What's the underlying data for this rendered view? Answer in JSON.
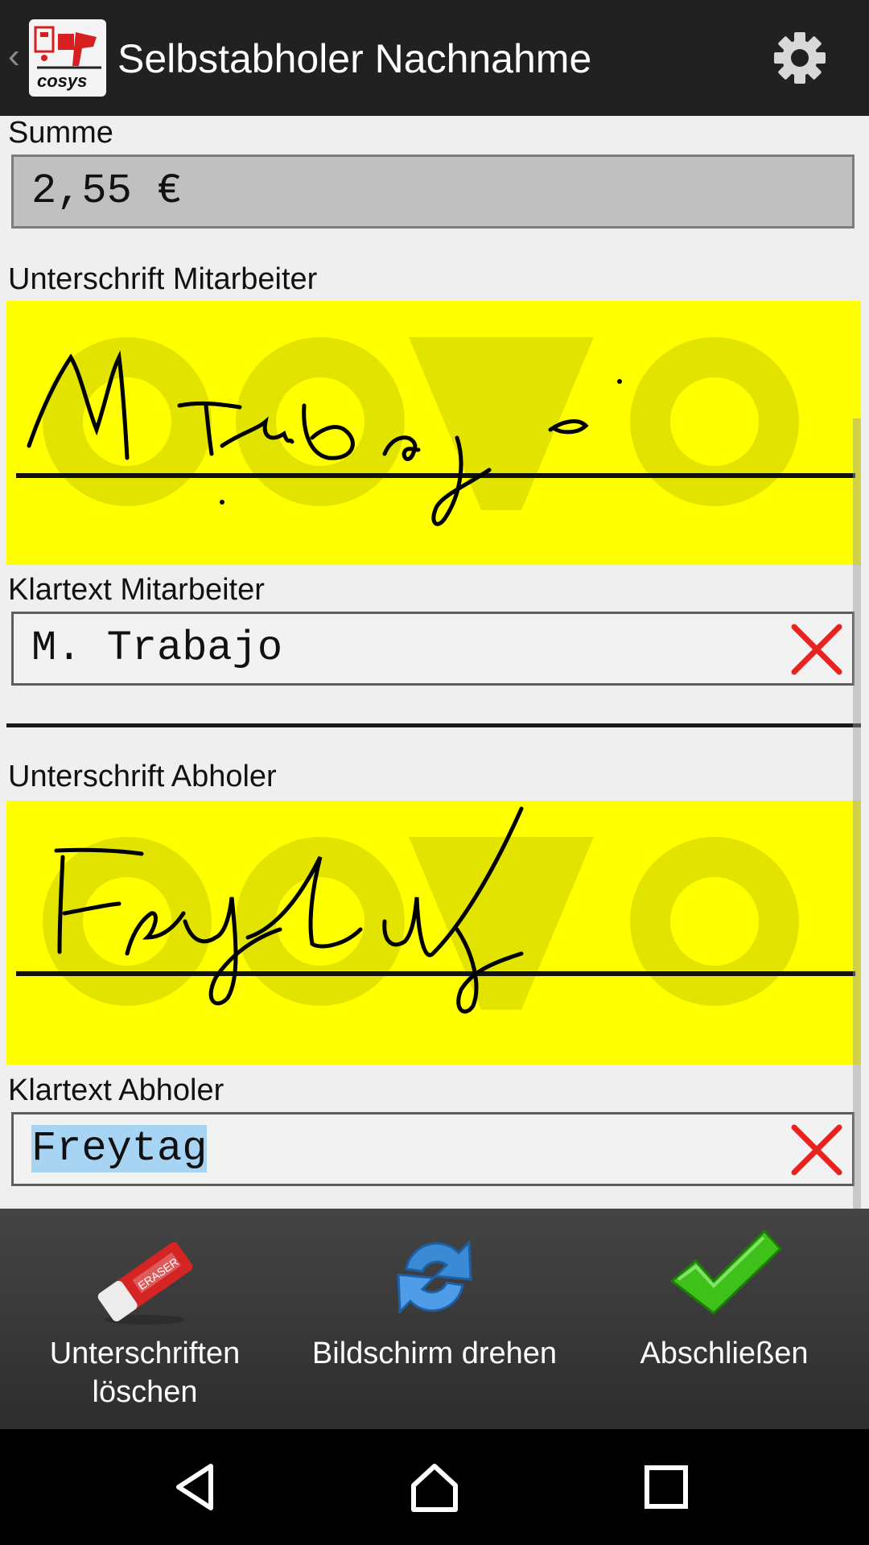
{
  "app": {
    "title": "Selbstabholer Nachnahme",
    "logo_text": "cosys"
  },
  "form": {
    "summe_label": "Summe",
    "summe_value": "2,55 €",
    "sig_employee_label": "Unterschrift Mitarbeiter",
    "employee_plain_label": "Klartext Mitarbeiter",
    "employee_plain_value": "M. Trabajo",
    "sig_collector_label": "Unterschrift Abholer",
    "collector_plain_label": "Klartext Abholer",
    "collector_plain_value": "Freytag"
  },
  "toolbar": {
    "clear_label": "Unterschriften löschen",
    "rotate_label": "Bildschirm drehen",
    "finish_label": "Abschließen"
  },
  "icons": {
    "back": "chevron-left-icon",
    "settings": "gear-icon",
    "clear_field": "red-x-icon",
    "eraser": "eraser-icon",
    "rotate": "refresh-icon",
    "finish": "checkmark-icon",
    "nav_back": "triangle-back-icon",
    "nav_home": "home-icon",
    "nav_recents": "square-recents-icon"
  },
  "colors": {
    "signature_pad": "#ffff00",
    "clear_x": "#e8221f",
    "selection": "#a6d4f2",
    "actionbar": "#212121"
  }
}
